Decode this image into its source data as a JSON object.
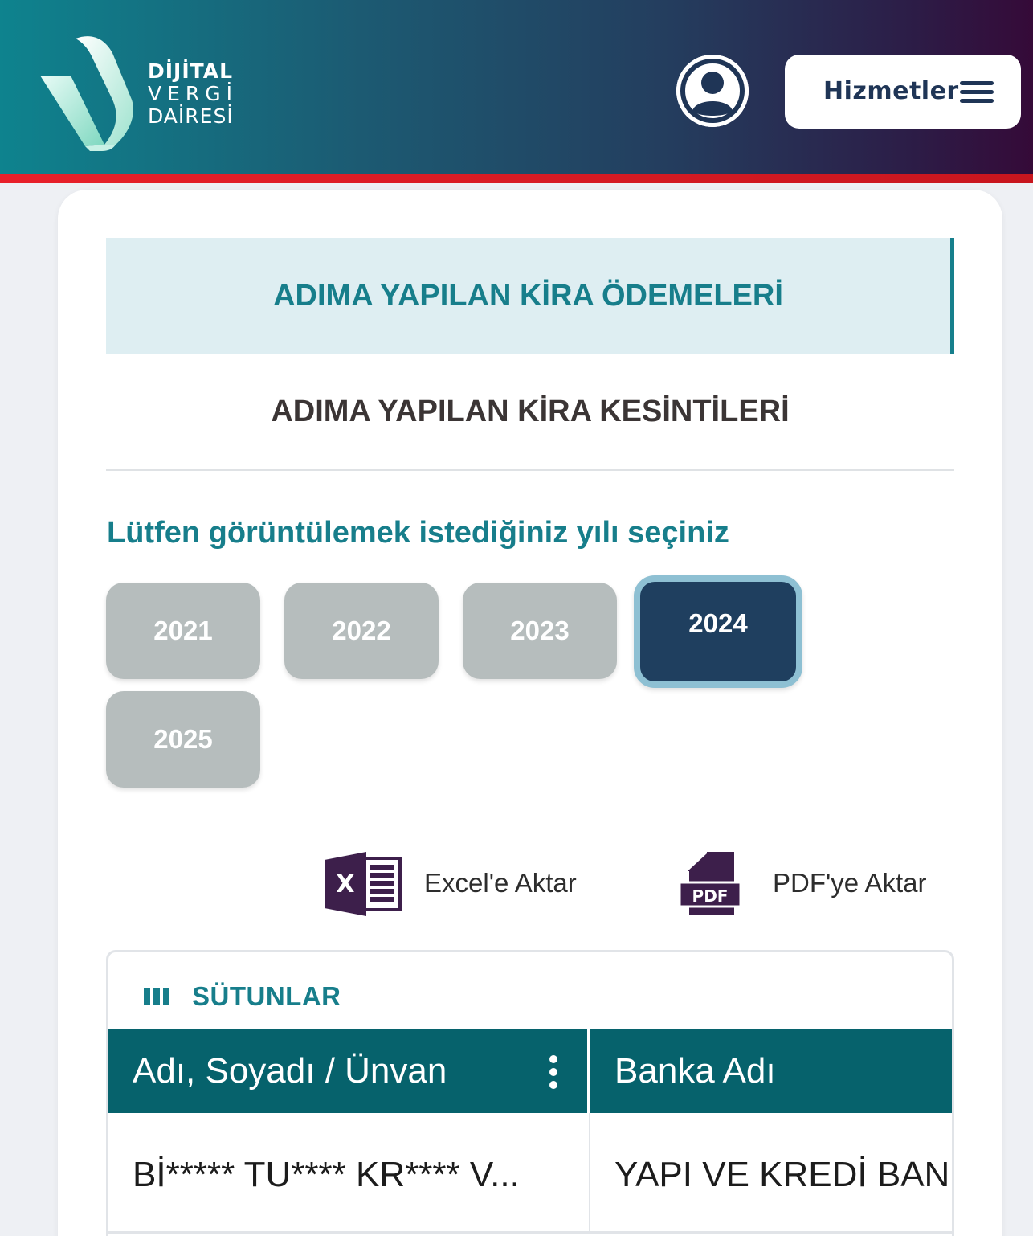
{
  "header": {
    "logo": {
      "line1": "DİJİTAL",
      "line2": "VERGİ",
      "line3": "DAİRESİ"
    },
    "services_label": "Hizmetler",
    "profile_icon": "user-circle-icon",
    "menu_icon": "hamburger-icon"
  },
  "tabs": {
    "active": "ADIMA YAPILAN KİRA ÖDEMELERİ",
    "inactive": "ADIMA YAPILAN KİRA KESİNTİLERİ"
  },
  "year_selector": {
    "prompt": "Lütfen görüntülemek istediğiniz yılı seçiniz",
    "years": [
      "2021",
      "2022",
      "2023",
      "2024",
      "2025"
    ],
    "selected": "2024"
  },
  "export": {
    "excel_label": "Excel'e Aktar",
    "pdf_label": "PDF'ye Aktar",
    "excel_icon": "excel-file-icon",
    "pdf_icon": "pdf-file-icon",
    "pdf_badge": "PDF",
    "excel_badge": "X"
  },
  "grid": {
    "columns_label": "SÜTUNLAR",
    "headers": [
      "Adı, Soyadı / Ünvan",
      "Banka Adı"
    ],
    "rows": [
      [
        "Bİ***** TU**** KR**** V...",
        "YAPI VE KREDİ BANKASI"
      ]
    ]
  },
  "colors": {
    "accent": "#177e8b",
    "header_dark": "#06626c",
    "selected_year": "#1f3f5f",
    "year_button": "#b6bdbd"
  }
}
